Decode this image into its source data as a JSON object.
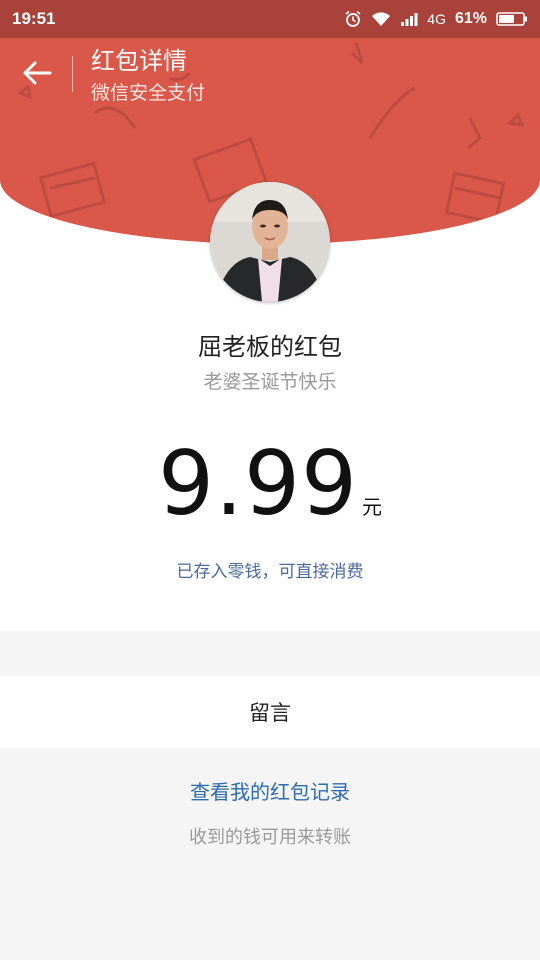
{
  "status_bar": {
    "time": "19:51",
    "network": "4G",
    "battery": "61%"
  },
  "header": {
    "title": "红包详情",
    "subtitle": "微信安全支付"
  },
  "packet": {
    "sender": "屈老板的红包",
    "wish": "老婆圣诞节快乐",
    "amount": "9.99",
    "unit": "元",
    "deposit_note": "已存入零钱，可直接消费"
  },
  "message": {
    "label": "留言"
  },
  "records": {
    "link": "查看我的红包记录",
    "tip": "收到的钱可用来转账"
  },
  "colors": {
    "header_red": "#d9584a",
    "status_bar": "#a9423a",
    "link_blue": "#2d6bb0"
  }
}
